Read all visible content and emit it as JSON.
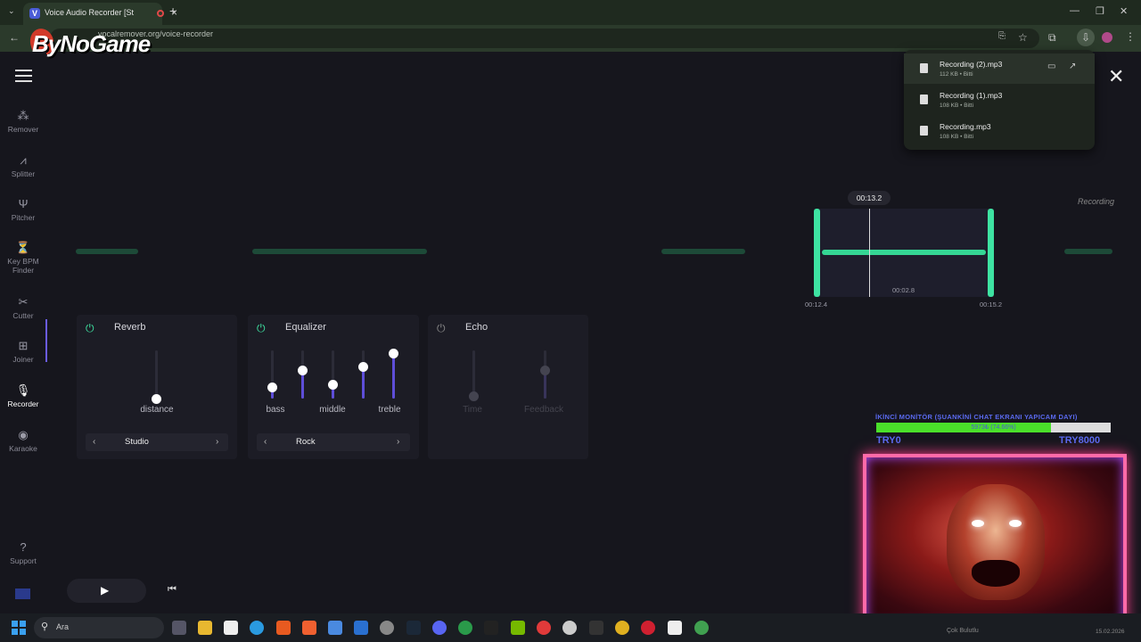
{
  "browser": {
    "tab_title": "Voice Audio Recorder [Stere",
    "favicon_letter": "V",
    "url": "vocalremover.org/voice-recorder"
  },
  "watermark": "ByNoGame",
  "sidebar": {
    "items": [
      {
        "label": "Remover",
        "icon": "remover-icon",
        "glyph": "⁂"
      },
      {
        "label": "Splitter",
        "icon": "splitter-icon",
        "glyph": "⩘"
      },
      {
        "label": "Pitcher",
        "icon": "tuning-fork-icon",
        "glyph": "Ψ"
      },
      {
        "label": "Key BPM",
        "label2": "Finder",
        "icon": "metronome-icon",
        "glyph": "⏳"
      },
      {
        "label": "Cutter",
        "icon": "scissors-icon",
        "glyph": "✂"
      },
      {
        "label": "Joiner",
        "icon": "joiner-icon",
        "glyph": "⊞"
      },
      {
        "label": "Recorder",
        "icon": "microphone-icon",
        "glyph": "🎙"
      },
      {
        "label": "Karaoke",
        "icon": "record-icon",
        "glyph": "◉"
      }
    ],
    "support_label": "Support",
    "active": "Recorder"
  },
  "recorder": {
    "status": "Recording",
    "current_time": "00:13.2",
    "selection_start": "00:12.4",
    "selection_end": "00:15.2",
    "selection_length": "00:02.8"
  },
  "effects": {
    "reverb": {
      "title": "Reverb",
      "enabled": true,
      "slider_label": "distance",
      "slider_value": 0.0,
      "preset": "Studio"
    },
    "equalizer": {
      "title": "Equalizer",
      "enabled": true,
      "labels": [
        "bass",
        "middle",
        "treble"
      ],
      "bands": [
        0.25,
        0.6,
        0.3,
        0.67,
        0.95
      ],
      "preset": "Rock"
    },
    "echo": {
      "title": "Echo",
      "enabled": false,
      "labels": [
        "Time",
        "Feedback"
      ],
      "values": [
        0.05,
        0.6
      ]
    }
  },
  "downloads": [
    {
      "name": "Recording (2).mp3",
      "meta": "112 KB • Bitti"
    },
    {
      "name": "Recording (1).mp3",
      "meta": "108 KB • Bitti"
    },
    {
      "name": "Recording.mp3",
      "meta": "108 KB • Bitti"
    }
  ],
  "overlay": {
    "title": "İKİNCİ MONİTÖR (ŞUANKİNİ CHAT EKRANI YAPICAM DAYI)",
    "goal_text": "5973₺ (74.66%)",
    "goal_fraction": 0.7466,
    "min_label": "TRY0",
    "max_label": "TRY8000"
  },
  "taskbar": {
    "search_placeholder": "Ara",
    "tray_text": "Çok Bulutlu",
    "date": "15.02.2026"
  },
  "colors": {
    "accent_green": "#3ee3a2",
    "accent_purple": "#5e4ed8",
    "background": "#16161d"
  }
}
